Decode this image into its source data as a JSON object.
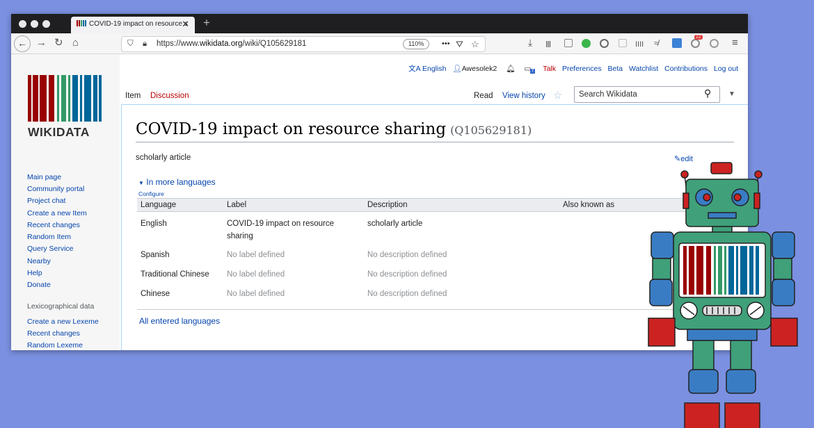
{
  "browser": {
    "tab_title": "COVID-19 impact on resource s",
    "tab_close": "✕",
    "new_tab": "+",
    "url_prefix": "https://www.",
    "url_domain": "wikidata.org",
    "url_path": "/wiki/Q105629181",
    "zoom": "110%",
    "page_actions": "•••",
    "badge_count": "22"
  },
  "site": {
    "logo_text": "WIKIDATA",
    "sidebar_nav": [
      "Main page",
      "Community portal",
      "Project chat",
      "Create a new Item",
      "Recent changes",
      "Random Item",
      "Query Service",
      "Nearby",
      "Help",
      "Donate"
    ],
    "lexeme_heading": "Lexicographical data",
    "lexeme_nav": [
      "Create a new Lexeme",
      "Recent changes",
      "Random Lexeme"
    ]
  },
  "personal": {
    "language": "English",
    "user": "Awesolek2",
    "notif_count": "7",
    "talk": "Talk",
    "preferences": "Preferences",
    "beta": "Beta",
    "watchlist": "Watchlist",
    "contributions": "Contributions",
    "logout": "Log out"
  },
  "tabs": {
    "item": "Item",
    "discussion": "Discussion",
    "read": "Read",
    "view_history": "View history"
  },
  "search": {
    "placeholder": "Search Wikidata"
  },
  "page": {
    "title": "COVID-19 impact on resource sharing",
    "qid": "(Q105629181)",
    "description": "scholarly article",
    "edit": "edit",
    "more_languages": "In more languages",
    "configure": "Configure",
    "all_languages": "All entered languages"
  },
  "table": {
    "headers": [
      "Language",
      "Label",
      "Description",
      "Also known as"
    ],
    "rows": [
      {
        "language": "English",
        "label_line1": "COVID-19 impact on resource",
        "label_line2": "sharing",
        "description": "scholarly article"
      },
      {
        "language": "Spanish",
        "label": "No label defined",
        "description": "No description defined"
      },
      {
        "language": "Traditional Chinese",
        "label": "No label defined",
        "description": "No description defined"
      },
      {
        "language": "Chinese",
        "label": "No label defined",
        "description": "No description defined"
      }
    ]
  },
  "colors": {
    "link": "#0645ad",
    "logo_red": "#990000",
    "logo_green": "#339966",
    "logo_blue": "#006699",
    "background": "#7b90e0"
  }
}
